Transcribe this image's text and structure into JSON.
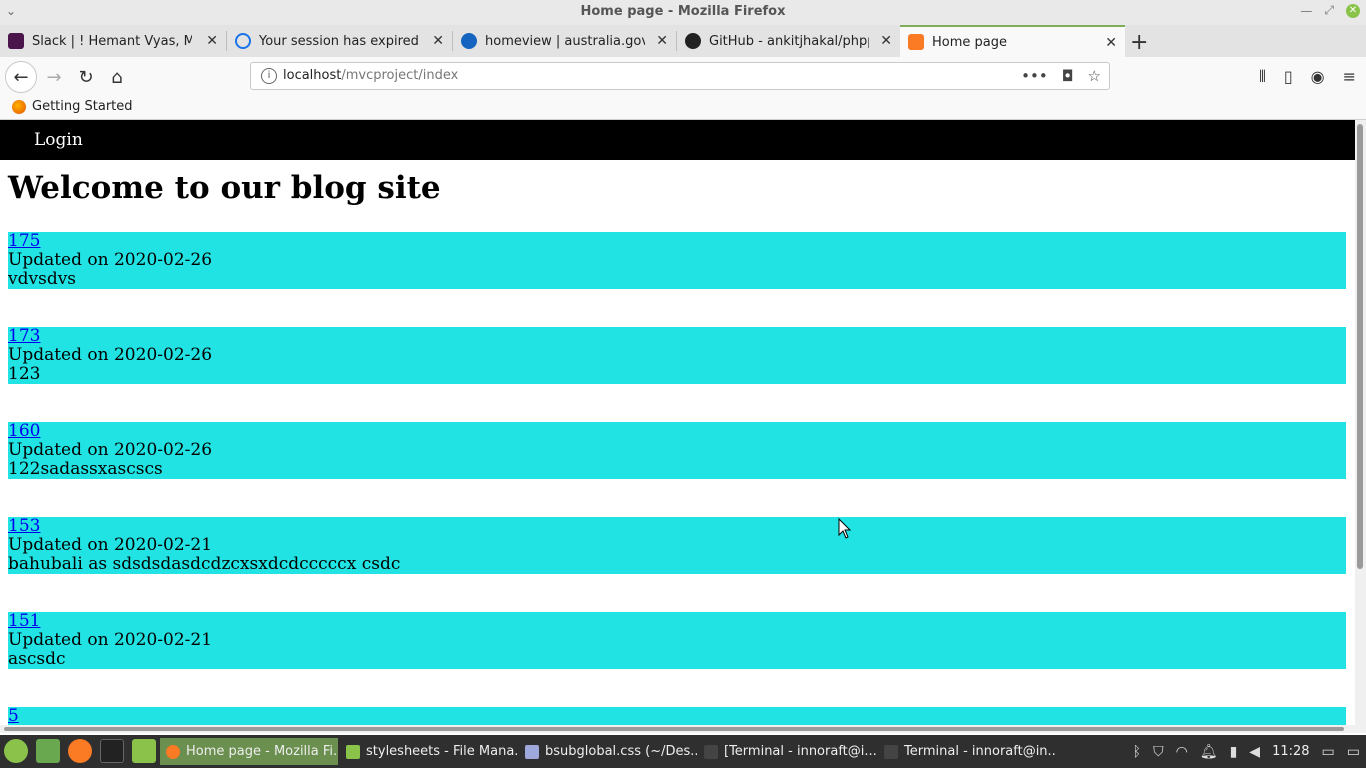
{
  "window": {
    "title": "Home page - Mozilla Firefox"
  },
  "tabs": [
    {
      "label": "Slack | ! Hemant Vyas, Mah",
      "color": "#4a154b"
    },
    {
      "label": "Your session has expired.",
      "color": "#1a73e8"
    },
    {
      "label": "homeview | australia.gov.au",
      "color": "#1565c0"
    },
    {
      "label": "GitHub - ankitjhakal/phppra",
      "color": "#222222"
    },
    {
      "label": "Home page",
      "color": "#fb7a24"
    }
  ],
  "navigation": {
    "url_host": "localhost",
    "url_path": "/mvcproject/index"
  },
  "bookmarks": {
    "getting_started": "Getting Started"
  },
  "site": {
    "nav_login": "Login",
    "heading": "Welcome to our blog site",
    "post_bg": "#22e3e3",
    "posts": [
      {
        "id": "175",
        "updated": "Updated on 2020-02-26",
        "body": "vdvsdvs"
      },
      {
        "id": "173",
        "updated": "Updated on 2020-02-26",
        "body": "123"
      },
      {
        "id": "160",
        "updated": "Updated on 2020-02-26",
        "body": "122sadassxascscs"
      },
      {
        "id": "153",
        "updated": "Updated on 2020-02-21",
        "body": "bahubali as sdsdsdasdcdzcxsxdcdcccccx csdc"
      },
      {
        "id": "151",
        "updated": "Updated on 2020-02-21",
        "body": "ascsdc"
      },
      {
        "id": "5",
        "updated": "",
        "body": ""
      }
    ]
  },
  "taskbar": {
    "tasks": [
      {
        "label": "Home page - Mozilla Fi...",
        "active": true,
        "color": "#fb7a24"
      },
      {
        "label": "stylesheets - File Mana...",
        "active": false,
        "color": "#8bc34a"
      },
      {
        "label": "bsubglobal.css (~/Des...",
        "active": false,
        "color": "#9fa8da"
      },
      {
        "label": "[Terminal - innoraft@i...",
        "active": false,
        "color": "#444444"
      },
      {
        "label": "Terminal - innoraft@in...",
        "active": false,
        "color": "#444444"
      }
    ],
    "clock": "11:28"
  }
}
